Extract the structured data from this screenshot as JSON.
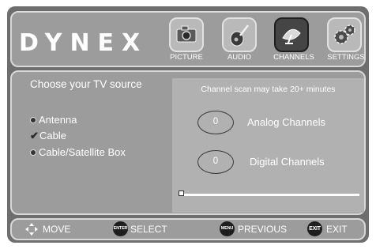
{
  "brand": "DYNEX",
  "tabs": [
    {
      "label": "PICTURE",
      "icon": "camera-icon",
      "active": false
    },
    {
      "label": "AUDIO",
      "icon": "guitar-icon",
      "active": false
    },
    {
      "label": "CHANNELS",
      "icon": "satellite-dish-icon",
      "active": true
    },
    {
      "label": "SETTINGS",
      "icon": "gears-icon",
      "active": false
    }
  ],
  "source": {
    "title": "Choose your TV source",
    "options": [
      {
        "label": "Antenna",
        "selected": false
      },
      {
        "label": "Cable",
        "selected": true
      },
      {
        "label": "Cable/Satellite Box",
        "selected": false
      }
    ]
  },
  "scan": {
    "note": "Channel scan may take 20+ minutes",
    "analog": {
      "count": "0",
      "label": "Analog Channels"
    },
    "digital": {
      "count": "0",
      "label": "Digital Channels"
    },
    "progress": 0
  },
  "footer": {
    "move": "MOVE",
    "select": "SELECT",
    "select_key": "ENTER",
    "previous": "PREVIOUS",
    "previous_key": "MENU",
    "exit": "EXIT",
    "exit_key": "EXIT"
  }
}
